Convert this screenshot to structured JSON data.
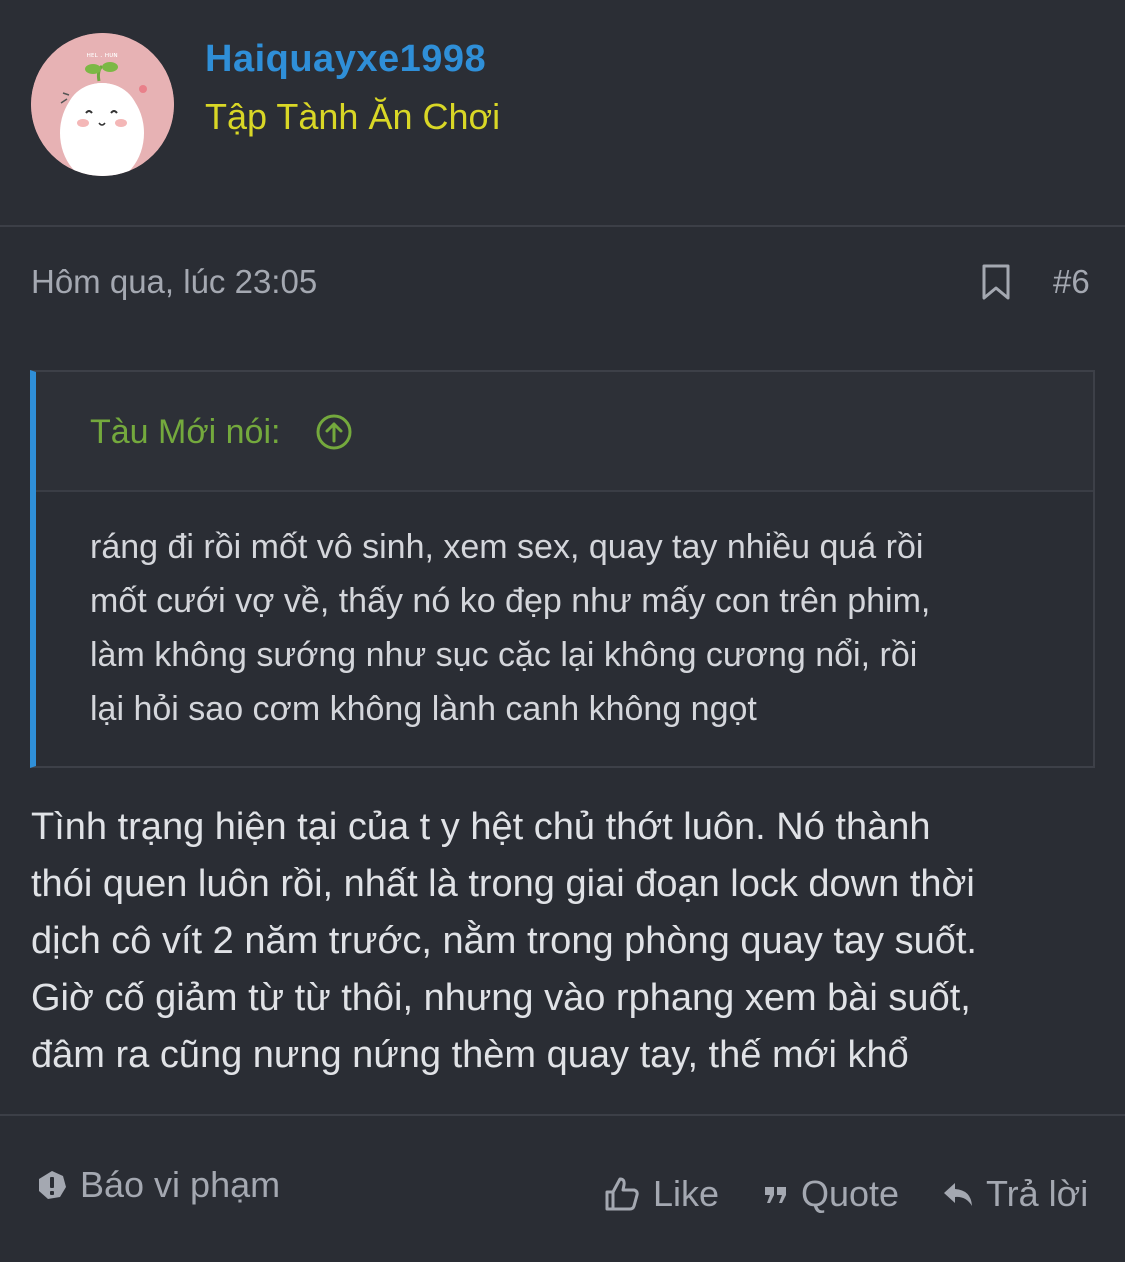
{
  "author": {
    "username": "Haiquayxe1998",
    "title": "Tập Tành Ăn Chơi"
  },
  "post": {
    "date": "Hôm qua, lúc 23:05",
    "number": "#6",
    "quote": {
      "author_label": "Tàu Mới nói:",
      "lines": [
        "ráng đi rồi mốt vô sinh, xem sex, quay tay nhiều quá rồi",
        "mốt cưới vợ về, thấy nó ko đẹp như mấy con trên phim,",
        "làm không sướng như sục cặc lại không cương nổi, rồi",
        "lại hỏi sao cơm không lành canh không ngọt"
      ]
    },
    "body_lines": [
      "Tình trạng hiện tại của t y hệt chủ thớt luôn. Nó thành",
      "thói quen luôn rồi, nhất là trong giai đoạn lock down thời",
      "dịch cô vít 2 năm trước, nằm trong phòng quay tay suốt.",
      "Giờ cố giảm từ từ thôi, nhưng vào rphang xem bài suốt,",
      "đâm ra cũng nưng nứng thèm quay tay, thế mới khổ"
    ]
  },
  "actions": {
    "report": "Báo vi phạm",
    "like": "Like",
    "quote": "Quote",
    "reply": "Trả lời"
  },
  "colors": {
    "background": "#2a2d34",
    "username": "#2f8fd8",
    "user_title": "#d9d726",
    "quote_author": "#74a93d",
    "quote_border": "#2f8fd8",
    "muted": "#a4a8b1",
    "text": "#e0e2e6"
  }
}
